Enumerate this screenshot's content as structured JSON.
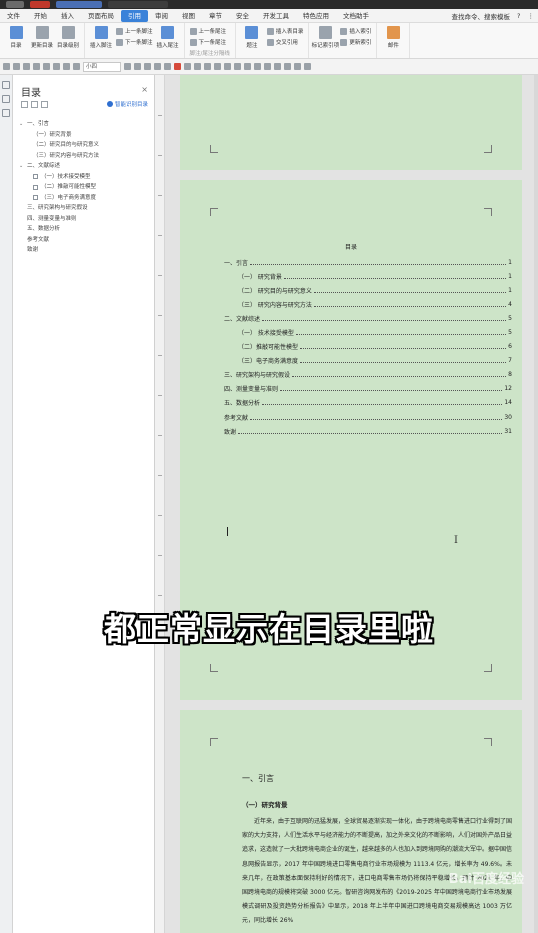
{
  "menubar": {
    "items": [
      "文件",
      "开始",
      "插入",
      "页面布局",
      "引用",
      "审阅",
      "视图",
      "章节",
      "安全",
      "开发工具",
      "特色应用",
      "文档助手"
    ],
    "active_index": 4,
    "search_label": "查找命令、搜索模板",
    "help": "?",
    "more": "⋮"
  },
  "ribbon": {
    "groups": [
      {
        "big": [
          "目录",
          "更新目录",
          "目录级别"
        ]
      },
      {
        "big": [
          "插入脚注",
          "插入尾注"
        ],
        "small": [
          "上一条脚注",
          "下一条脚注"
        ]
      },
      {
        "small": [
          "上一条尾注",
          "下一条尾注"
        ],
        "dim": [
          "脚注/尾注分隔线"
        ]
      },
      {
        "big": [
          "题注"
        ],
        "small": [
          "插入表目录",
          "交叉引用"
        ]
      },
      {
        "big": [
          "标记索引项"
        ],
        "small": [
          "插入索引",
          "更新索引"
        ]
      },
      {
        "big": [
          "邮件"
        ]
      }
    ]
  },
  "fmtbar": {
    "font_size": "小四"
  },
  "nav": {
    "title": "目录",
    "close": "×",
    "smart": "智能识别目录",
    "items": [
      {
        "level": 1,
        "toggle": "⌄",
        "text": "一、引言"
      },
      {
        "level": 2,
        "text": "（一）研究背景"
      },
      {
        "level": 2,
        "text": "（二）研究目的与研究意义"
      },
      {
        "level": 2,
        "text": "（三）研究内容与研究方法"
      },
      {
        "level": 1,
        "toggle": "⌄",
        "text": "二、文献综述"
      },
      {
        "level": 2,
        "box": true,
        "text": "（一）技术接受模型"
      },
      {
        "level": 2,
        "box": true,
        "text": "（二）推敲可能性模型"
      },
      {
        "level": 2,
        "box": true,
        "text": "（三）电子商务满意度"
      },
      {
        "level": 0,
        "text": "三、研究架构与研究假设"
      },
      {
        "level": 0,
        "text": "四、测量变量与准则"
      },
      {
        "level": 0,
        "text": "五、数据分析"
      },
      {
        "level": 0,
        "text": "参考文献"
      },
      {
        "level": 0,
        "text": "致谢"
      }
    ]
  },
  "toc": {
    "title": "目录",
    "entries": [
      {
        "level": 1,
        "text": "一、引言",
        "page": "1"
      },
      {
        "level": 2,
        "text": "（一） 研究背景",
        "page": "1"
      },
      {
        "level": 2,
        "text": "（二） 研究目的与研究意义",
        "page": "1"
      },
      {
        "level": 2,
        "text": "（三） 研究内容与研究方法",
        "page": "4"
      },
      {
        "level": 1,
        "text": "二、文献综述",
        "page": "5"
      },
      {
        "level": 2,
        "text": "（一） 技术接受模型",
        "page": "5"
      },
      {
        "level": 2,
        "text": "（二）推敲可能性模型",
        "page": "6"
      },
      {
        "level": 2,
        "text": "（三）电子商务满意度",
        "page": "7"
      },
      {
        "level": 1,
        "text": "三、研究架构与研究假设",
        "page": "8"
      },
      {
        "level": 1,
        "text": "四、测量变量与准则",
        "page": "12"
      },
      {
        "level": 1,
        "text": "五、数据分析",
        "page": "14"
      },
      {
        "level": 1,
        "text": "参考文献",
        "page": "30"
      },
      {
        "level": 1,
        "text": "致谢",
        "page": "31"
      }
    ]
  },
  "page3": {
    "chapter": "一、引言",
    "section": "（一）研究背景",
    "paragraph": "近年来，由于互联网的迅猛发展，全球贸易逐渐实现一体化，由于跨境电商零售进口行业得到了国家的大力支持，人们生活水平与经济能力的不断提高，加之外来文化的不断影响，人们对国外产品日益追求，这造就了一大批跨境电商企业的诞生，越来越多的人也加入到跨境网购的潮流大军中。据中国信息网报告显示，2017 年中国跨境进口零售电商行业市场规模为 1113.4 亿元，增长率为 49.6%。未来几年，在政策基本面保持利好的情况下，进口电商零售市场仍将保持平稳增长，预计 2021 年，中国跨境电商的规模将突破 3000 亿元。智研咨询网发布的《2019-2025 年中国跨境电商行业市场发展模式调研及投资趋势分析报告》中显示，2018 年上半年中国进口跨境电商交易规模高达 1003 万亿元，同比增长 26%"
  },
  "overlay": {
    "subtitle": "都正常显示在目录里啦",
    "watermark": "Bai百度经验"
  }
}
